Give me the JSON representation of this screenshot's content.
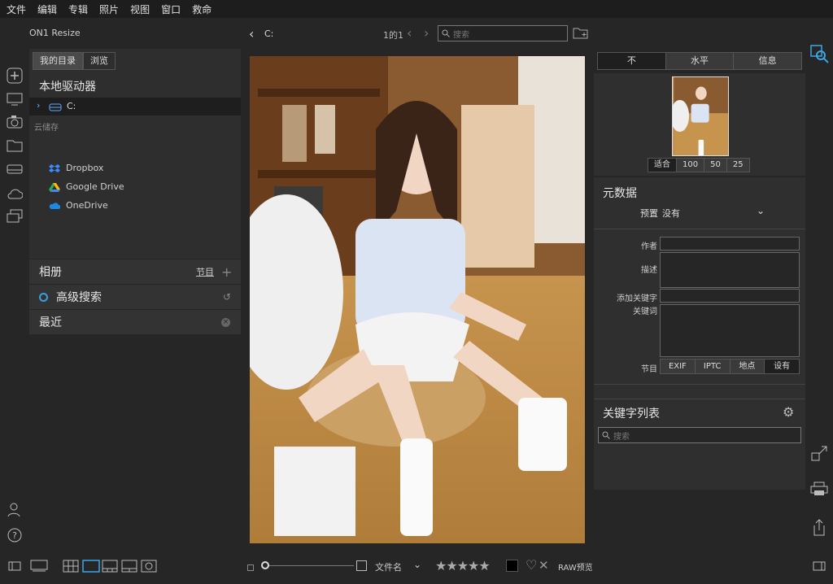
{
  "menu": [
    "文件",
    "编辑",
    "专辑",
    "照片",
    "视图",
    "窗口",
    "救命"
  ],
  "app": {
    "title": "ON1 Resize",
    "accent": "#b03ad0"
  },
  "left_panel": {
    "tabs": [
      {
        "label": "我的目录",
        "active": true
      },
      {
        "label": "浏览",
        "active": false
      }
    ],
    "drives_header": "本地驱动器",
    "drive": "C:",
    "cloud_label": "云储存",
    "clouds": [
      {
        "label": "Dropbox",
        "icon": "dropbox-icon"
      },
      {
        "label": "Google Drive",
        "icon": "google-drive-icon"
      },
      {
        "label": "OneDrive",
        "icon": "onedrive-icon"
      }
    ],
    "albums": {
      "label": "相册",
      "action": "节目"
    },
    "advanced_search": "高级搜索",
    "recent": "最近"
  },
  "toolbar": {
    "path": "C:",
    "count": "1的1",
    "search_placeholder": "搜索"
  },
  "right_panel": {
    "tabs": [
      {
        "label": "不",
        "active": true
      },
      {
        "label": "水平",
        "active": false
      },
      {
        "label": "信息",
        "active": false
      }
    ],
    "zoom": [
      {
        "label": "适合",
        "active": true
      },
      {
        "label": "100"
      },
      {
        "label": "50"
      },
      {
        "label": "25"
      }
    ],
    "metadata_header": "元数据",
    "preset_label": "预置",
    "preset_value": "没有",
    "fields": {
      "author": "作者",
      "description": "描述",
      "add_keyword": "添加关键字",
      "keywords": "关键词",
      "section": "节目"
    },
    "section_tabs": [
      "EXIF",
      "IPTC",
      "地点",
      "设有"
    ],
    "keyword_list_header": "关键字列表",
    "keyword_search_placeholder": "搜索"
  },
  "bottom": {
    "sort_label": "文件名",
    "raw_label": "RAW预览",
    "stars": "★★★★★"
  }
}
